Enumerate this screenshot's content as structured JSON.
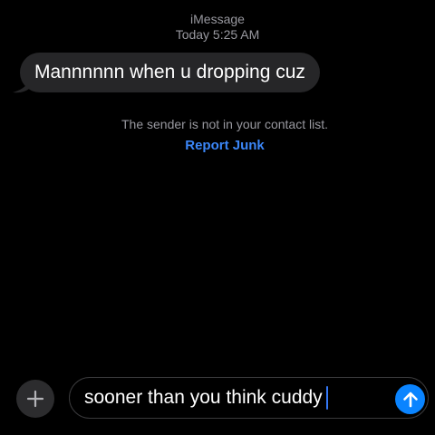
{
  "header": {
    "service": "iMessage",
    "timestamp": "Today 5:25 AM"
  },
  "messages": [
    {
      "direction": "incoming",
      "text": "Mannnnnn when u dropping cuz"
    }
  ],
  "notice": {
    "text": "The sender is not in your contact list.",
    "action_label": "Report Junk",
    "action_color": "#3b86f7"
  },
  "composer": {
    "plus_icon": "plus-icon",
    "draft_text": "sooner than you think cuddy",
    "send_icon": "arrow-up-icon",
    "send_color": "#0a84ff"
  },
  "colors": {
    "background": "#000000",
    "incoming_bubble": "#262628",
    "secondary_text": "#98989f"
  }
}
